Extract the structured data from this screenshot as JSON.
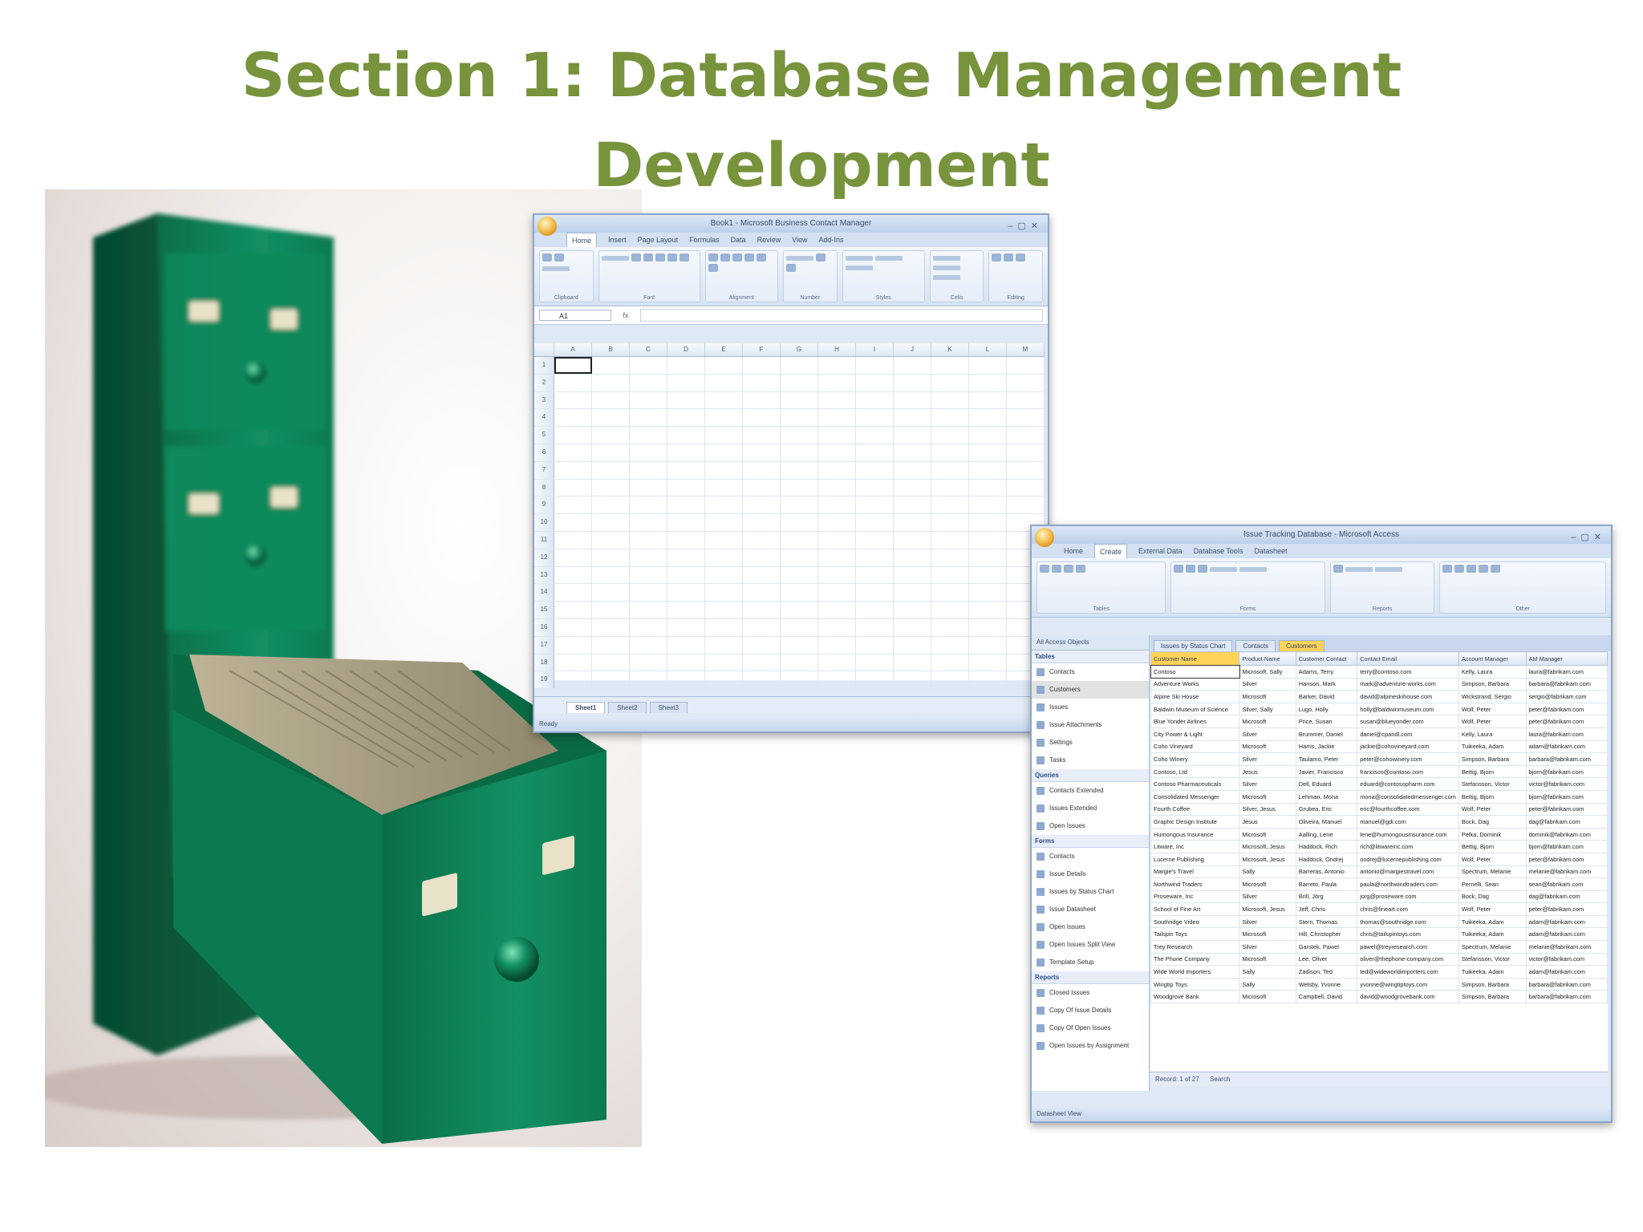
{
  "slide": {
    "title_line1": "Section 1: Database Management",
    "title_line2": "Development"
  },
  "colors": {
    "title": "#77933c",
    "cabinet": "#0f8a5c",
    "window_frame": "#8fa6c6"
  },
  "excel": {
    "title": "Book1 - Microsoft Business Contact Manager",
    "tabs": [
      "Home",
      "Insert",
      "Page Layout",
      "Formulas",
      "Data",
      "Review",
      "View",
      "Add-Ins"
    ],
    "groups": [
      "Clipboard",
      "Font",
      "Alignment",
      "Number",
      "Styles",
      "Cells",
      "Editing"
    ],
    "namebox": "A1",
    "columns": [
      "A",
      "B",
      "C",
      "D",
      "E",
      "F",
      "G",
      "H",
      "I",
      "J",
      "K",
      "L",
      "M"
    ],
    "rows": [
      "1",
      "2",
      "3",
      "4",
      "5",
      "6",
      "7",
      "8",
      "9",
      "10",
      "11",
      "12",
      "13",
      "14",
      "15",
      "16",
      "17",
      "18",
      "19"
    ],
    "sheets": [
      "Sheet1",
      "Sheet2",
      "Sheet3"
    ],
    "status": "Ready"
  },
  "access": {
    "title": "Issue Tracking Database - Microsoft Access",
    "tabs": [
      "Home",
      "Create",
      "External Data",
      "Database Tools",
      "Datasheet"
    ],
    "groups": [
      "Tables",
      "Forms",
      "Reports",
      "Other"
    ],
    "nav_header": "All Access Objects",
    "nav_groups": [
      {
        "name": "Tables",
        "items": [
          "Contacts",
          "Customers",
          "Issues",
          "Issue Attachments",
          "Settings",
          "Tasks"
        ]
      },
      {
        "name": "Queries",
        "items": [
          "Contacts Extended",
          "Issues Extended",
          "Open Issues"
        ]
      },
      {
        "name": "Forms",
        "items": [
          "Contacts",
          "Issue Details",
          "Issues by Status Chart",
          "Issue Datasheet",
          "Open Issues",
          "Open Issues Split View",
          "Template Setup"
        ]
      },
      {
        "name": "Reports",
        "items": [
          "Closed Issues",
          "Copy Of Issue Details",
          "Copy Of Open Issues",
          "Open Issues by Assignment"
        ]
      }
    ],
    "doc_tabs": [
      "Issues by Status Chart",
      "Contacts",
      "Customers"
    ],
    "columns": [
      "Customer Name",
      "Product Name",
      "Customer Contact",
      "Contact Email",
      "Account Manager",
      "AM Manager"
    ],
    "rows": [
      [
        "Contoso",
        "Microsoft, Sally",
        "Adams, Terry",
        "terry@contoso.com",
        "Kelly, Laura",
        "laura@fabrikam.com"
      ],
      [
        "Adventure Works",
        "Silver",
        "Hanson, Mark",
        "mark@adventure-works.com",
        "Simpson, Barbara",
        "barbara@fabrikam.com"
      ],
      [
        "Alpine Ski House",
        "Microsoft",
        "Barker, David",
        "david@alpineskihouse.com",
        "Wickstrand, Sergio",
        "sergio@fabrikam.com"
      ],
      [
        "Baldwin Museum of Science",
        "Silver, Sally",
        "Lugo, Holly",
        "holly@baldwinmuseum.com",
        "Wolf, Peter",
        "peter@fabrikam.com"
      ],
      [
        "Blue Yonder Airlines",
        "Microsoft",
        "Price, Susan",
        "susan@blueyonder.com",
        "Wolf, Peter",
        "peter@fabrikam.com"
      ],
      [
        "City Power & Light",
        "Silver",
        "Brummer, Daniel",
        "daniel@cpandl.com",
        "Kelly, Laura",
        "laura@fabrikam.com"
      ],
      [
        "Coho Vineyard",
        "Microsoft",
        "Harris, Jackie",
        "jackie@cohovineyard.com",
        "Tuikeeka, Adam",
        "adam@fabrikam.com"
      ],
      [
        "Coho Winery",
        "Silver",
        "Taulamo, Peter",
        "peter@cohowinery.com",
        "Simpson, Barbara",
        "barbara@fabrikam.com"
      ],
      [
        "Contoso, Ltd",
        "Jesus",
        "Javier, Francisco",
        "francisco@contoso.com",
        "Bettig, Bjorn",
        "bjorn@fabrikam.com"
      ],
      [
        "Contoso Pharmaceuticals",
        "Silver",
        "Dell, Eduard",
        "eduard@contosopharm.com",
        "Stefansson, Victor",
        "victor@fabrikam.com"
      ],
      [
        "Consolidated Messenger",
        "Microsoft",
        "Lehman, Mona",
        "mona@consolidatedmessenger.com",
        "Bettig, Bjorn",
        "bjorn@fabrikam.com"
      ],
      [
        "Fourth Coffee",
        "Silver, Jesus",
        "Grubea, Eric",
        "eric@fourthcoffee.com",
        "Wolf, Peter",
        "peter@fabrikam.com"
      ],
      [
        "Graphic Design Institute",
        "Jesus",
        "Oliveira, Manuel",
        "manuel@gdi.com",
        "Bock, Dag",
        "dag@fabrikam.com"
      ],
      [
        "Humongous Insurance",
        "Microsoft",
        "Aalling, Lene",
        "lene@humongousinsurance.com",
        "Pelka, Dominik",
        "dominik@fabrikam.com"
      ],
      [
        "Litware, Inc",
        "Microsoft, Jesus",
        "Haddock, Rich",
        "rich@litwareinc.com",
        "Bettig, Bjorn",
        "bjorn@fabrikam.com"
      ],
      [
        "Lucerne Publishing",
        "Microsoft, Jesus",
        "Haddock, Ondrej",
        "ondrej@lucernepublishing.com",
        "Wolf, Peter",
        "peter@fabrikam.com"
      ],
      [
        "Margie's Travel",
        "Sally",
        "Barreras, Antonio",
        "antonio@margiestravel.com",
        "Spectrum, Melanie",
        "melanie@fabrikam.com"
      ],
      [
        "Northwind Traders",
        "Microsoft",
        "Barreto, Paula",
        "paula@northwindtraders.com",
        "Pernelli, Sean",
        "sean@fabrikam.com"
      ],
      [
        "Proseware, Inc",
        "Silver",
        "Brill, Jörg",
        "jorg@proseware.com",
        "Bock, Dag",
        "dag@fabrikam.com"
      ],
      [
        "School of Fine Art",
        "Microsoft, Jesus",
        "Jeff, Chris",
        "chris@fineart.com",
        "Wolf, Peter",
        "peter@fabrikam.com"
      ],
      [
        "Southridge Video",
        "Silver",
        "Stern, Thomas",
        "thomas@southridge.com",
        "Tuikeeka, Adam",
        "adam@fabrikam.com"
      ],
      [
        "Tailspin Toys",
        "Microsoft",
        "Hill, Christopher",
        "chris@tailspintoys.com",
        "Tuikeeka, Adam",
        "adam@fabrikam.com"
      ],
      [
        "Trey Research",
        "Silver",
        "Garstek, Pawel",
        "pawel@treyresearch.com",
        "Spectrum, Melanie",
        "melanie@fabrikam.com"
      ],
      [
        "The Phone Company",
        "Microsoft",
        "Lee, Oliver",
        "oliver@thephone-company.com",
        "Stefansson, Victor",
        "victor@fabrikam.com"
      ],
      [
        "Wide World Importers",
        "Sally",
        "Zadison, Ted",
        "ted@wideworldimporters.com",
        "Tuikeeka, Adam",
        "adam@fabrikam.com"
      ],
      [
        "Wingtip Toys",
        "Sally",
        "Welsby, Yvonne",
        "yvonne@wingtiptoys.com",
        "Simpson, Barbara",
        "barbara@fabrikam.com"
      ],
      [
        "Woodgrove Bank",
        "Microsoft",
        "Campbell, David",
        "david@woodgrovebank.com",
        "Simpson, Barbara",
        "barbara@fabrikam.com"
      ]
    ],
    "record_nav": "Record: 1 of 27",
    "search": "Search",
    "status": "Datasheet View"
  }
}
